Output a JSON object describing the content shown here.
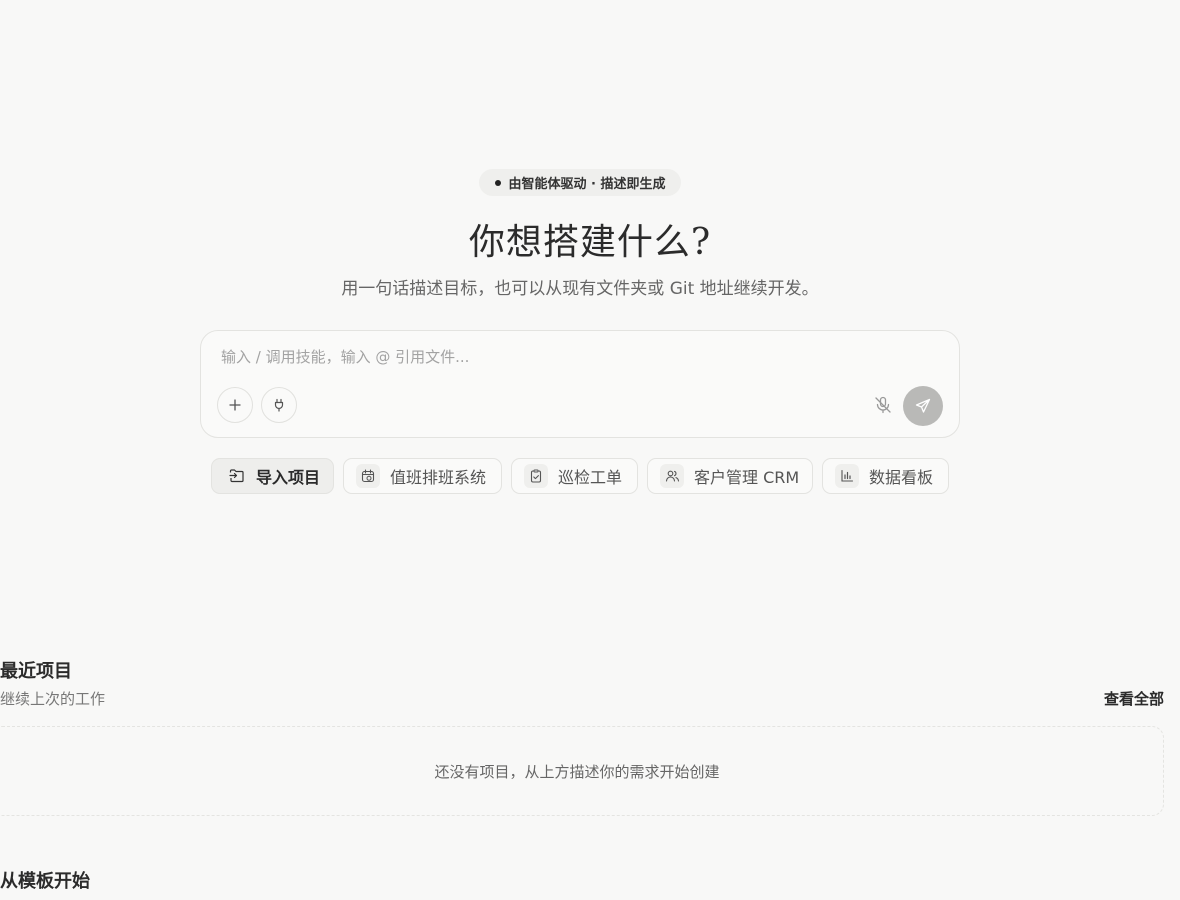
{
  "hero": {
    "badge": "由智能体驱动 · 描述即生成",
    "title": "你想搭建什么?",
    "subtitle": "用一句话描述目标，也可以从现有文件夹或 Git 地址继续开发。"
  },
  "prompt": {
    "placeholder": "输入 / 调用技能，输入 @ 引用文件...",
    "value": ""
  },
  "chips": [
    {
      "label": "导入项目",
      "icon": "folder-import-icon"
    },
    {
      "label": "值班排班系统",
      "icon": "calendar-clock-icon"
    },
    {
      "label": "巡检工单",
      "icon": "clipboard-check-icon"
    },
    {
      "label": "客户管理 CRM",
      "icon": "users-icon"
    },
    {
      "label": "数据看板",
      "icon": "bar-chart-icon"
    }
  ],
  "recent": {
    "title": "最近项目",
    "subtitle": "继续上次的工作",
    "view_all": "查看全部",
    "empty": "还没有项目，从上方描述你的需求开始创建"
  },
  "templates": {
    "title": "从模板开始"
  },
  "colors": {
    "background": "#f8f8f7",
    "send_button": "#b9b9b7"
  }
}
